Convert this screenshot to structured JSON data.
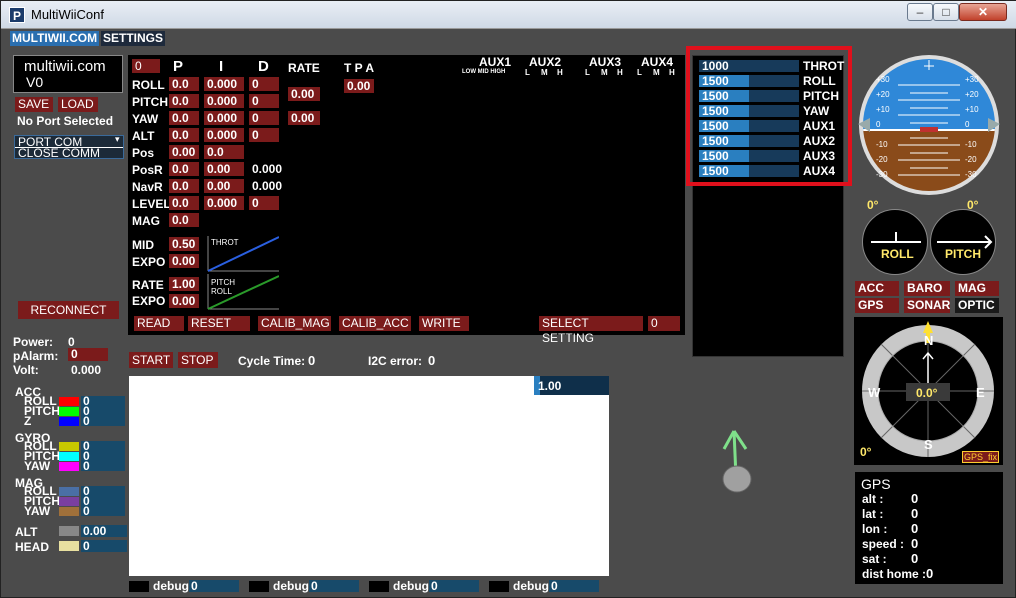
{
  "window": {
    "title": "MultiWiiConf",
    "icon": "P"
  },
  "tabs": [
    {
      "label": "MULTIWII.COM"
    },
    {
      "label": "SETTINGS"
    }
  ],
  "left": {
    "brand": "multiwii.com",
    "version": "V0",
    "save": "SAVE",
    "load": "LOAD",
    "port_status": "No Port Selected",
    "port_com": "PORT COM",
    "close_comm": "CLOSE COMM",
    "reconnect": "RECONNECT",
    "power_label": "Power:",
    "power_value": "0",
    "palarm_label": "pAlarm:",
    "palarm_value": "0",
    "volt_label": "Volt:",
    "volt_value": "0.000",
    "acc": {
      "title": "ACC",
      "roll": "ROLL",
      "pitch": "PITCH",
      "z": "Z",
      "v1": "0",
      "v2": "0",
      "v3": "0"
    },
    "gyro": {
      "title": "GYRO",
      "roll": "ROLL",
      "pitch": "PITCH",
      "yaw": "YAW",
      "v1": "0",
      "v2": "0",
      "v3": "0"
    },
    "mag": {
      "title": "MAG",
      "roll": "ROLL",
      "pitch": "PITCH",
      "yaw": "YAW",
      "v1": "0",
      "v2": "0",
      "v3": "0"
    },
    "alt_label": "ALT",
    "alt_value": "0.00",
    "head_label": "HEAD",
    "head_value": "0",
    "colors": {
      "roll_acc": "#ff0000",
      "pitch_acc": "#00ff00",
      "z_acc": "#0000ff",
      "roll_gyro": "#c8c800",
      "pitch_gyro": "#00ffff",
      "yaw_gyro": "#ff00ff",
      "roll_mag": "#4a6fa5",
      "pitch_mag": "#7a3fa0",
      "yaw_mag": "#a0703a",
      "alt": "#888888",
      "head": "#e8e0a0"
    }
  },
  "pid": {
    "profile": "0",
    "headers": {
      "p": "P",
      "i": "I",
      "d": "D",
      "rate": "RATE",
      "tpa": "T P A"
    },
    "rows": [
      {
        "name": "ROLL",
        "p": "0.0",
        "i": "0.000",
        "d": "0"
      },
      {
        "name": "PITCH",
        "p": "0.0",
        "i": "0.000",
        "d": "0"
      },
      {
        "name": "YAW",
        "p": "0.0",
        "i": "0.000",
        "d": "0"
      },
      {
        "name": "ALT",
        "p": "0.0",
        "i": "0.000",
        "d": "0"
      },
      {
        "name": "Pos",
        "p": "0.00",
        "i": "0.0",
        "d": ""
      },
      {
        "name": "PosR",
        "p": "0.0",
        "i": "0.00",
        "d": "0.000"
      },
      {
        "name": "NavR",
        "p": "0.0",
        "i": "0.00",
        "d": "0.000"
      },
      {
        "name": "LEVEL",
        "p": "0.0",
        "i": "0.000",
        "d": "0"
      },
      {
        "name": "MAG",
        "p": "0.0",
        "i": "",
        "d": ""
      }
    ],
    "rate_rp": "0.00",
    "rate_yaw": "0.00",
    "tpa": "0.00",
    "mid_label": "MID",
    "mid": "0.50",
    "expo_label": "EXPO",
    "expo1": "0.00",
    "rate_label": "RATE",
    "rate": "1.00",
    "expo2": "0.00",
    "throt_graph": "THROT",
    "pitch_graph": "PITCH",
    "roll_graph": "ROLL",
    "read": "READ",
    "reset": "RESET",
    "calib_mag": "CALIB_MAG",
    "calib_acc": "CALIB_ACC",
    "write": "WRITE",
    "select_setting": "SELECT SETTING",
    "setting_value": "0"
  },
  "aux": {
    "names": [
      "AUX1",
      "AUX2",
      "AUX3",
      "AUX4"
    ],
    "sub1": "LOW MID HIGH",
    "sub": [
      "L",
      "M",
      "H"
    ]
  },
  "graph": {
    "start": "START",
    "stop": "STOP",
    "cycle_label": "Cycle Time:",
    "cycle_value": "0",
    "i2c_label": "I2C error:",
    "i2c_value": "0",
    "scale": "1.00",
    "debug": [
      {
        "label": "debug",
        "value": "0"
      },
      {
        "label": "debug",
        "value": "0"
      },
      {
        "label": "debug",
        "value": "0"
      },
      {
        "label": "debug",
        "value": "0"
      }
    ]
  },
  "rc": [
    {
      "value": "1000",
      "label": "THROT",
      "fill": 0.0
    },
    {
      "value": "1500",
      "label": "ROLL",
      "fill": 0.5
    },
    {
      "value": "1500",
      "label": "PITCH",
      "fill": 0.5
    },
    {
      "value": "1500",
      "label": "YAW",
      "fill": 0.5
    },
    {
      "value": "1500",
      "label": "AUX1",
      "fill": 0.5
    },
    {
      "value": "1500",
      "label": "AUX2",
      "fill": 0.5
    },
    {
      "value": "1500",
      "label": "AUX3",
      "fill": 0.5
    },
    {
      "value": "1500",
      "label": "AUX4",
      "fill": 0.5
    }
  ],
  "horizon": {
    "ticks": [
      "+30",
      "+20",
      "+10",
      "0",
      "-10",
      "-20",
      "-30"
    ],
    "roll_angle": "0°",
    "pitch_angle": "0°",
    "roll_label": "ROLL",
    "pitch_label": "PITCH"
  },
  "sensors": {
    "acc": "ACC",
    "baro": "BARO",
    "mag": "MAG",
    "gps": "GPS",
    "sonar": "SONAR",
    "optic": "OPTIC"
  },
  "compass": {
    "n": "N",
    "s": "S",
    "e": "E",
    "w": "W",
    "heading": "0.0°",
    "alt_angle": "0°",
    "gps_fix": "GPS_fix"
  },
  "gps": {
    "title": "GPS",
    "alt_label": "alt :",
    "alt": "0",
    "lat_label": "lat :",
    "lat": "0",
    "lon_label": "lon :",
    "lon": "0",
    "speed_label": "speed :",
    "speed": "0",
    "sat_label": "sat :",
    "sat": "0",
    "dist_label": "dist home :",
    "dist": "0"
  }
}
